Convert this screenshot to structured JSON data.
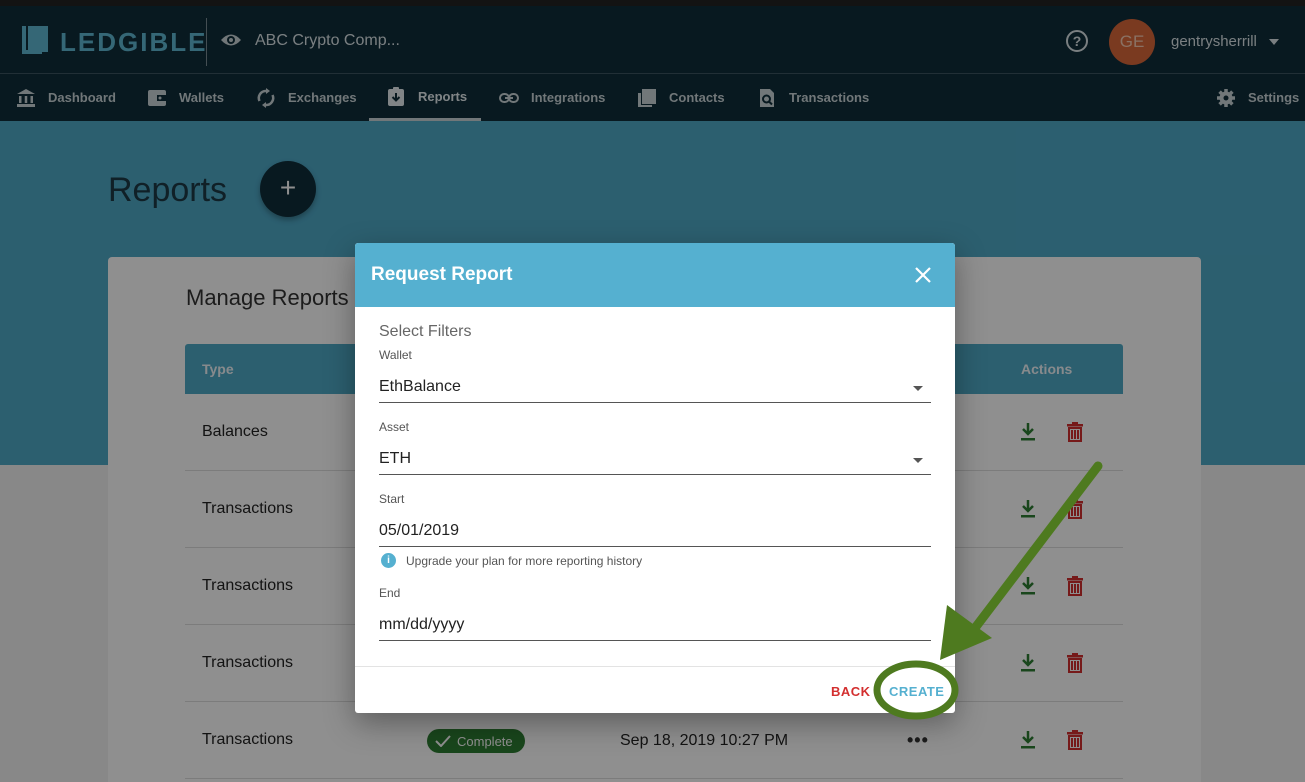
{
  "header": {
    "logo_text": "LEDGIBLE",
    "company": "ABC Crypto Comp...",
    "avatar_initials": "GE",
    "username": "gentrysherrill"
  },
  "nav": {
    "items": [
      {
        "label": "Dashboard",
        "icon": "bank-icon"
      },
      {
        "label": "Wallets",
        "icon": "wallet-icon"
      },
      {
        "label": "Exchanges",
        "icon": "sync-icon"
      },
      {
        "label": "Reports",
        "icon": "clipboard-download-icon",
        "active": true
      },
      {
        "label": "Integrations",
        "icon": "link-icon"
      },
      {
        "label": "Contacts",
        "icon": "contacts-icon"
      },
      {
        "label": "Transactions",
        "icon": "doc-search-icon"
      }
    ],
    "settings_label": "Settings"
  },
  "page": {
    "title": "Reports",
    "fab_label": "+"
  },
  "card": {
    "title": "Manage Reports",
    "columns": {
      "type": "Type",
      "actions": "Actions"
    },
    "rows": [
      {
        "type": "Balances"
      },
      {
        "type": "Transactions"
      },
      {
        "type": "Transactions"
      },
      {
        "type": "Transactions"
      },
      {
        "type": "Transactions",
        "status": "Complete",
        "date": "Sep 18, 2019 10:27 PM",
        "more": "•••"
      }
    ]
  },
  "modal": {
    "title": "Request Report",
    "section": "Select Filters",
    "wallet_label": "Wallet",
    "wallet_value": "EthBalance",
    "asset_label": "Asset",
    "asset_value": "ETH",
    "start_label": "Start",
    "start_value": "05/01/2019",
    "hint": "Upgrade your plan for more reporting history",
    "end_label": "End",
    "end_value": "mm/dd/yyyy",
    "back_label": "BACK",
    "create_label": "CREATE"
  },
  "colors": {
    "nav_bg": "#0f2e3a",
    "accent": "#55b0d0",
    "danger": "#d32f2f",
    "success": "#2e7d32",
    "annotation": "#4e7a1f"
  }
}
